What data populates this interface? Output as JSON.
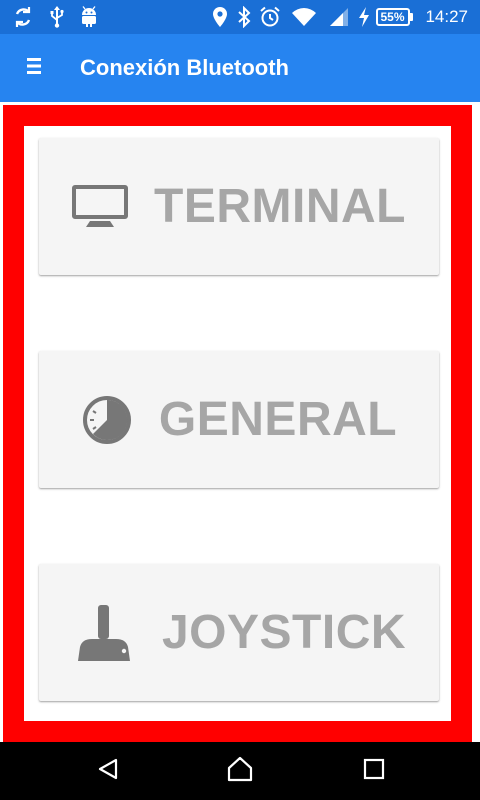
{
  "status_bar": {
    "time": "14:27",
    "battery": "55%",
    "left_icons": [
      "sync-icon",
      "usb-icon",
      "android-icon"
    ],
    "right_icons": [
      "location-icon",
      "bluetooth-icon",
      "alarm-icon",
      "wifi-icon",
      "signal-icon",
      "charging-icon",
      "battery-icon"
    ]
  },
  "app_bar": {
    "title": "Conexión Bluetooth",
    "menu_icon": "menu-icon",
    "color": "#2684f0"
  },
  "buttons": [
    {
      "label": "TERMINAL",
      "icon": "monitor-icon"
    },
    {
      "label": "GENERAL",
      "icon": "clock-icon"
    },
    {
      "label": "JOYSTICK",
      "icon": "joystick-icon"
    }
  ],
  "frame_color": "#ff0000",
  "nav_bar": {
    "icons": [
      "back-icon",
      "home-icon",
      "recents-icon"
    ]
  }
}
